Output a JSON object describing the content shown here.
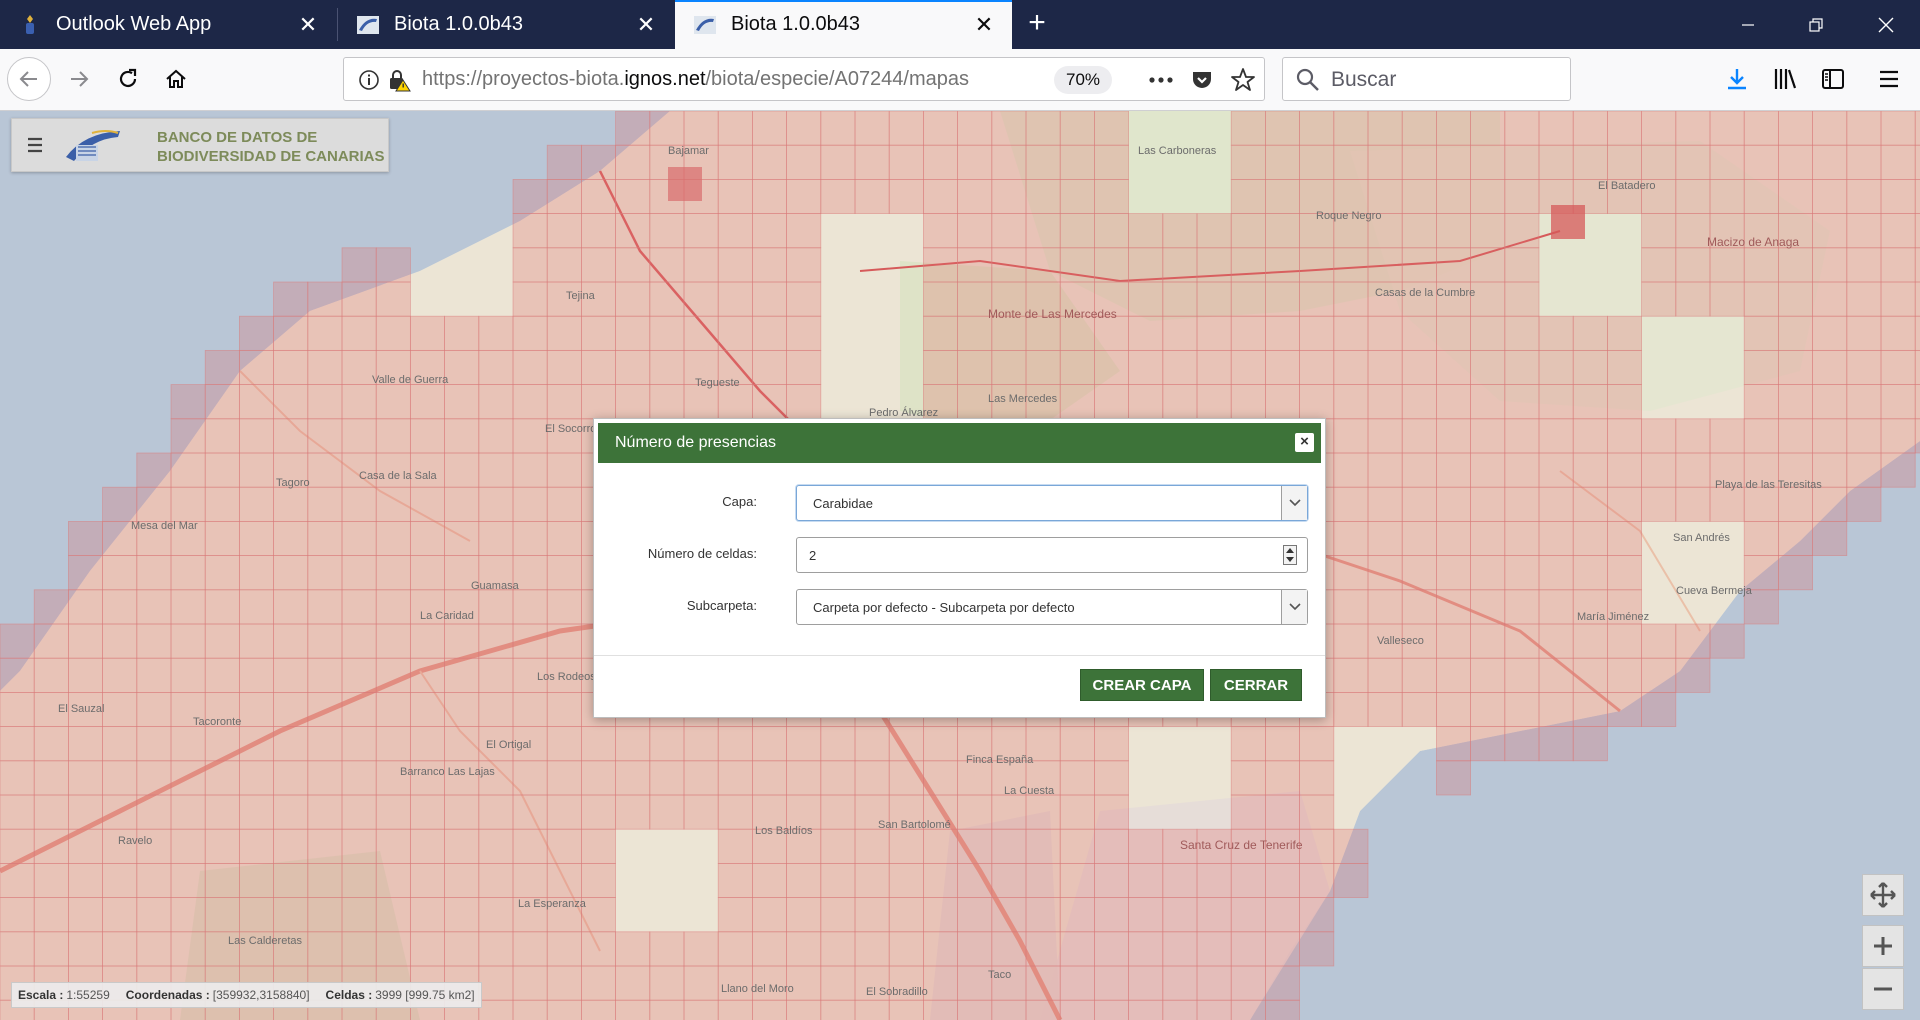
{
  "tabs": [
    {
      "title": "Outlook Web App",
      "active": false
    },
    {
      "title": "Biota 1.0.0b43",
      "active": false
    },
    {
      "title": "Biota 1.0.0b43",
      "active": true
    }
  ],
  "toolbar": {
    "url_prefix": "https://proyectos-biota.",
    "url_host": "ignos.net",
    "url_path": "/biota/especie/A07244/mapas",
    "zoom": "70%",
    "search_placeholder": "Buscar"
  },
  "brand": {
    "line1": "BANCO DE DATOS DE",
    "line2": "BIODIVERSIDAD DE CANARIAS"
  },
  "map": {
    "labels": [
      "Bajamar",
      "Las Carboneras",
      "El Batadero",
      "Roque Negro",
      "Macizo de Anaga",
      "Casas de la Cumbre",
      "Tejina",
      "Monte de Las Mercedes",
      "Valle de Guerra",
      "Tegueste",
      "Pedro Álvarez",
      "Las Mercedes",
      "El Socorro",
      "Tagoro",
      "Casa de la Sala",
      "Mesa del Mar",
      "Guamasa",
      "La Caridad",
      "Los Rodeos",
      "El Sauzal",
      "Tacoronte",
      "El Ortigal",
      "Barranco Las Lajas",
      "Ravelo",
      "La Esperanza",
      "Las Calderetas",
      "Los Baldíos",
      "San Bartolomé",
      "La Cuesta",
      "Finca España",
      "Santa Cruz de Tenerife",
      "Taco",
      "El Sobradillo",
      "Llano del Moro",
      "San Andrés",
      "Playa de las Teresitas",
      "Cueva Bermeja",
      "María Jiménez",
      "Valleseco"
    ]
  },
  "dialog": {
    "title": "Número de presencias",
    "close_symbol": "×",
    "fields": {
      "capa": {
        "label": "Capa:",
        "value": "Carabidae"
      },
      "celdas": {
        "label": "Número de celdas:",
        "value": "2"
      },
      "subcarpeta": {
        "label": "Subcarpeta:",
        "value": "Carpeta por defecto - Subcarpeta por defecto"
      }
    },
    "buttons": {
      "create": "CREAR CAPA",
      "close": "CERRAR"
    }
  },
  "status": {
    "scale_label": "Escala :",
    "scale_value": "1:55259",
    "coords_label": "Coordenadas :",
    "coords_value": "[359932,3158840]",
    "cells_label": "Celdas :",
    "cells_value": "3999 [999.75 km2]"
  },
  "colors": {
    "tab_bar": "#1d2747",
    "dialog_green": "#3d7339",
    "grid_red": "#e06a6a",
    "sea": "#b9c6d6"
  },
  "icons": [
    "back-arrow-icon",
    "forward-arrow-icon",
    "reload-icon",
    "home-icon",
    "info-icon",
    "insecure-lock-icon",
    "more-icon",
    "pocket-icon",
    "star-icon",
    "search-icon",
    "download-icon",
    "library-icon",
    "sidebar-icon",
    "menu-icon",
    "pan-icon",
    "zoom-in-icon",
    "zoom-out-icon"
  ]
}
